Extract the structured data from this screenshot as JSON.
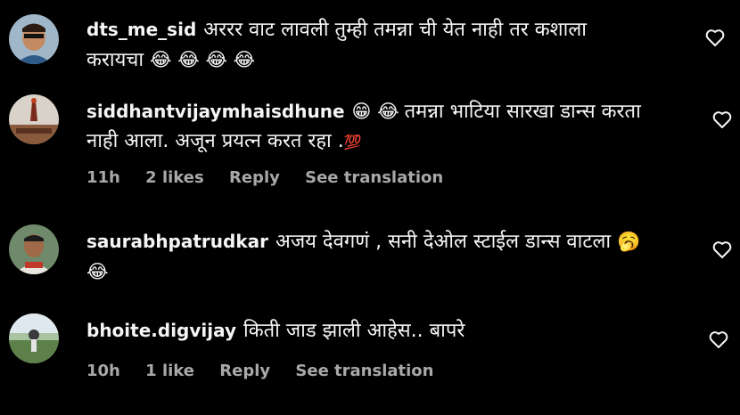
{
  "comments": [
    {
      "username": "dts_me_sid",
      "line1": "अररर वाट लावली तुम्ही तमन्ना ची येत नाही तर कशाला",
      "line2": "करायचा",
      "emojis": "😂 😂 😂 😂",
      "heart_icon": "heart-outline-icon"
    },
    {
      "username": "siddhantvijaymhaisdhune",
      "emojis_inline": "😁 😂",
      "line1": "तमन्ना भाटिया सारखा डान्स करता",
      "line2": "नाही आला. अजून प्रयत्न करत रहा .",
      "line2_emoji": "💯",
      "time": "11h",
      "likes": "2 likes",
      "reply": "Reply",
      "translation": "See translation",
      "heart_icon": "heart-outline-icon"
    },
    {
      "username": "saurabhpatrudkar",
      "line1": "अजय देवगणं , सनी देओल स्टाईल डान्स वाटला",
      "line1_emoji": "🥱",
      "line2_emoji": "😂",
      "heart_icon": "heart-outline-icon"
    },
    {
      "username": "bhoite.digvijay",
      "line1": "किती जाड झाली आहेस.. बापरे",
      "time": "10h",
      "likes": "1 like",
      "reply": "Reply",
      "translation": "See translation",
      "heart_icon": "heart-outline-icon"
    }
  ]
}
